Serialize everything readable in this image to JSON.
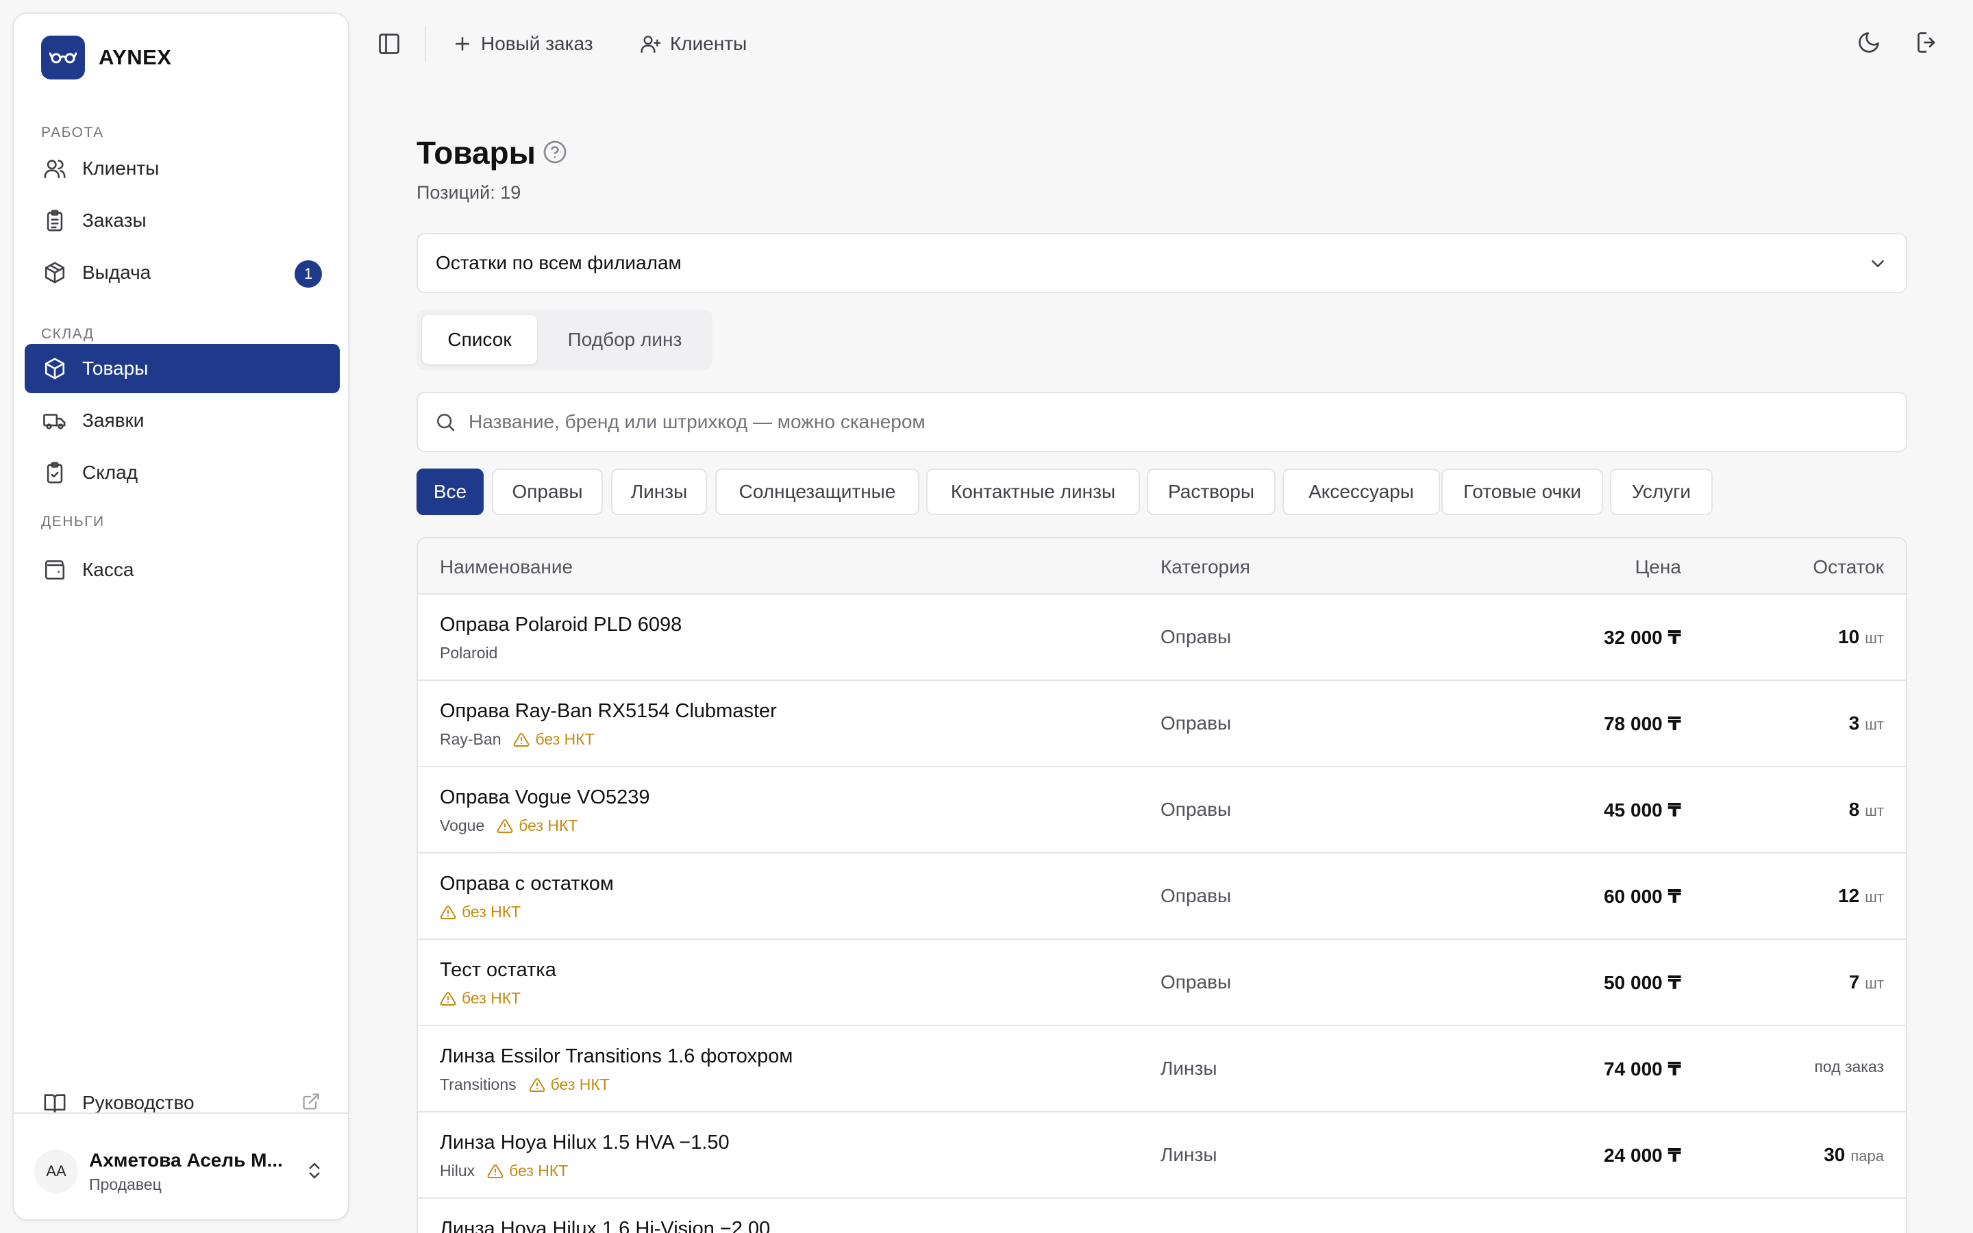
{
  "brand": {
    "name": "AYNEX"
  },
  "colors": {
    "accent": "#1f3a8a",
    "warning": "#c48a12",
    "border": "#e4e4e7",
    "background": "#f7f7f8"
  },
  "sidebar": {
    "sections": {
      "work": "РАБОТА",
      "warehouse": "СКЛАД",
      "money": "ДЕНЬГИ"
    },
    "items": [
      {
        "label": "Клиенты",
        "icon": "users-icon"
      },
      {
        "label": "Заказы",
        "icon": "clipboard-list-icon"
      },
      {
        "label": "Выдача",
        "icon": "package-icon",
        "badge": "1"
      },
      {
        "label": "Товары",
        "icon": "box-icon",
        "active": true
      },
      {
        "label": "Заявки",
        "icon": "truck-icon"
      },
      {
        "label": "Склад",
        "icon": "clipboard-check-icon"
      },
      {
        "label": "Касса",
        "icon": "wallet-icon"
      }
    ],
    "guide": {
      "label": "Руководство",
      "icon": "book-icon"
    },
    "user": {
      "initials": "АА",
      "name": "Ахметова Асель М...",
      "role": "Продавец"
    }
  },
  "topbar": {
    "new_order": "Новый заказ",
    "clients": "Клиенты"
  },
  "page": {
    "title": "Товары",
    "subtitle": "Позиций: 19",
    "branch_select": "Остатки по всем филиалам",
    "tabs": [
      "Список",
      "Подбор линз"
    ],
    "active_tab": "Список",
    "search_placeholder": "Название, бренд или штрихкод — можно сканером",
    "filters": [
      "Все",
      "Оправы",
      "Линзы",
      "Солнцезащитные",
      "Контактные линзы",
      "Растворы",
      "Аксессуары",
      "Готовые очки",
      "Услуги"
    ],
    "active_filter": "Все"
  },
  "table": {
    "headers": {
      "name": "Наименование",
      "category": "Категория",
      "price": "Цена",
      "stock": "Остаток"
    },
    "warning_label": "без НКТ",
    "rows": [
      {
        "name": "Оправа Polaroid PLD 6098",
        "brand": "Polaroid",
        "warning": false,
        "category": "Оправы",
        "price": "32 000 ₸",
        "stock": "10",
        "unit": "шт"
      },
      {
        "name": "Оправа Ray-Ban RX5154 Clubmaster",
        "brand": "Ray-Ban",
        "warning": true,
        "category": "Оправы",
        "price": "78 000 ₸",
        "stock": "3",
        "unit": "шт"
      },
      {
        "name": "Оправа Vogue VO5239",
        "brand": "Vogue",
        "warning": true,
        "category": "Оправы",
        "price": "45 000 ₸",
        "stock": "8",
        "unit": "шт"
      },
      {
        "name": "Оправа с остатком",
        "brand": "",
        "warning": true,
        "category": "Оправы",
        "price": "60 000 ₸",
        "stock": "12",
        "unit": "шт"
      },
      {
        "name": "Тест остатка",
        "brand": "",
        "warning": true,
        "category": "Оправы",
        "price": "50 000 ₸",
        "stock": "7",
        "unit": "шт"
      },
      {
        "name": "Линза Essilor Transitions 1.6 фотохром",
        "brand": "Transitions",
        "warning": true,
        "category": "Линзы",
        "price": "74 000 ₸",
        "stock": "",
        "unit": "",
        "stock_note": "под заказ"
      },
      {
        "name": "Линза Hoya Hilux 1.5 HVA −1.50",
        "brand": "Hilux",
        "warning": true,
        "category": "Линзы",
        "price": "24 000 ₸",
        "stock": "30",
        "unit": "пара"
      },
      {
        "name": "Линза Hoya Hilux 1.6 Hi-Vision −2.00",
        "brand": "",
        "warning": false,
        "category": "",
        "price": "",
        "stock": "",
        "unit": ""
      }
    ]
  }
}
